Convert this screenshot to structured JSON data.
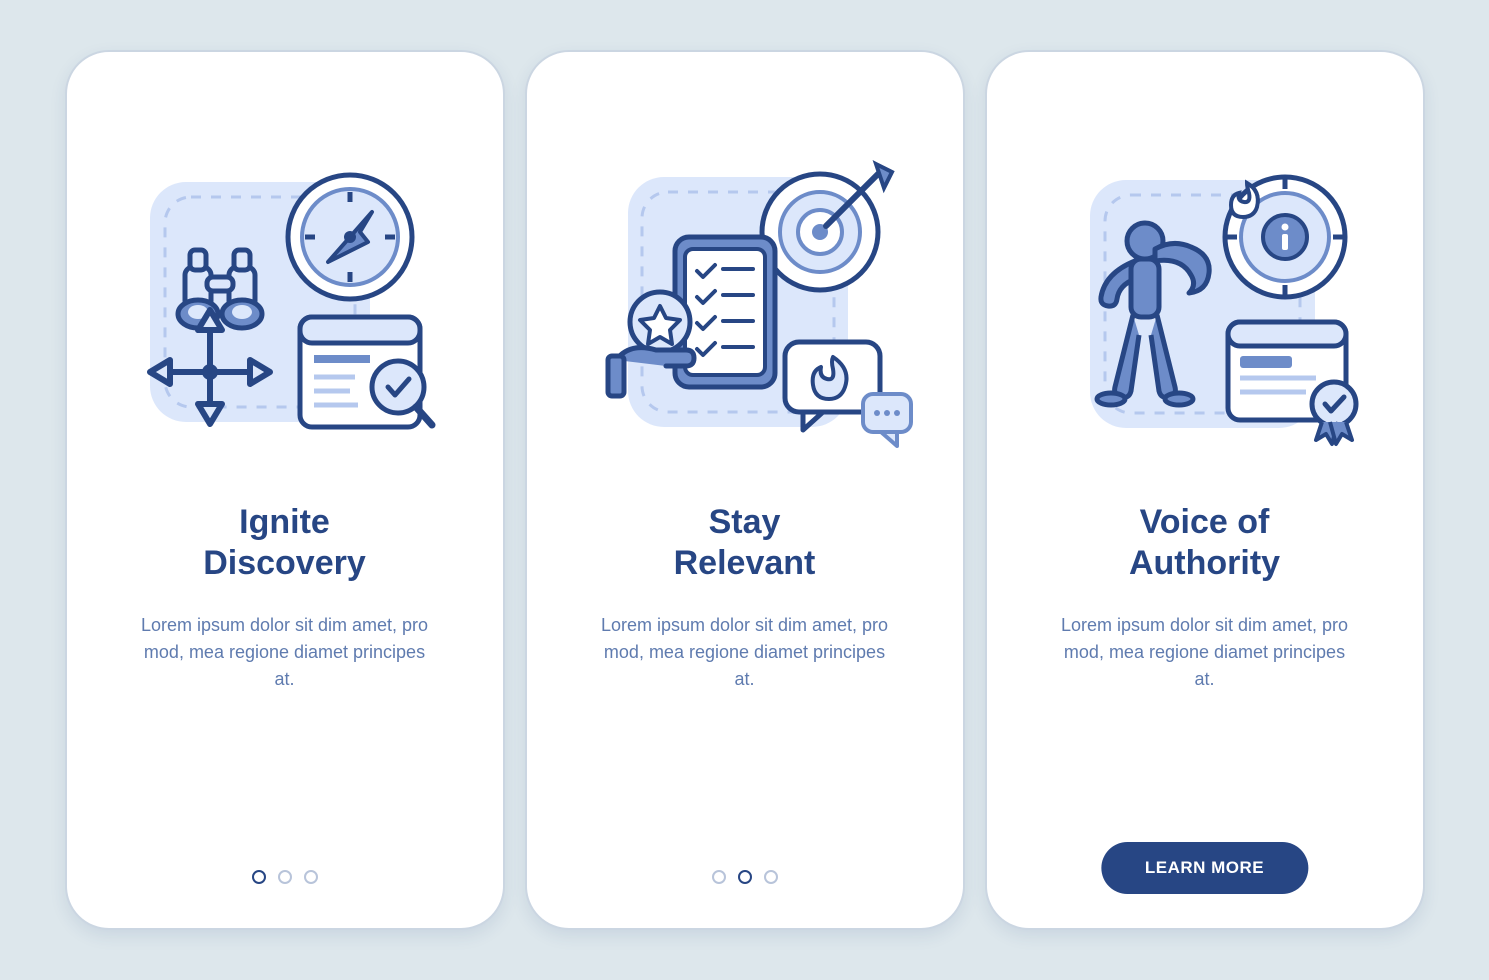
{
  "colors": {
    "darkBlue": "#274684",
    "lightBlue": "#dce7fb",
    "midBlue": "#6d8cc9",
    "stroke": "#274684",
    "bg": "#dde7ec"
  },
  "cards": [
    {
      "title": "Ignite\nDiscovery",
      "body": "Lorem ipsum dolor sit dim amet, pro mod, mea regione diamet principes at.",
      "showPager": true,
      "activeDot": 0,
      "showButton": false
    },
    {
      "title": "Stay\nRelevant",
      "body": "Lorem ipsum dolor sit dim amet, pro mod, mea regione diamet principes at.",
      "showPager": true,
      "activeDot": 1,
      "showButton": false
    },
    {
      "title": "Voice of\nAuthority",
      "body": "Lorem ipsum dolor sit dim amet, pro mod, mea regione diamet principes at.",
      "showPager": false,
      "activeDot": 2,
      "showButton": true,
      "buttonLabel": "LEARN MORE"
    }
  ]
}
